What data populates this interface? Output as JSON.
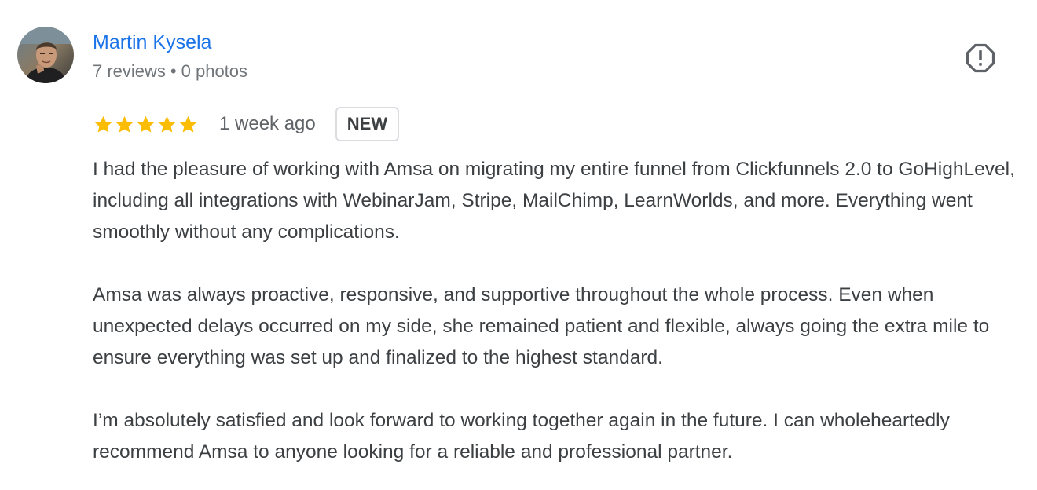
{
  "reviewer": {
    "name": "Martin Kysela",
    "reviews_count": "7 reviews",
    "separator": "•",
    "photos_count": "0 photos",
    "avatar_icon": "profile-photo"
  },
  "rating": {
    "stars": 5,
    "max_stars": 5,
    "star_color": "#fbbc04",
    "time": "1 week ago",
    "badge": "NEW"
  },
  "report": {
    "icon": "report-flag-icon"
  },
  "review": {
    "paragraphs": [
      "I had the pleasure of working with Amsa on migrating my entire funnel from Clickfunnels 2.0 to GoHighLevel, including all integrations with WebinarJam, Stripe, MailChimp, LearnWorlds, and more. Everything went smoothly without any complications.",
      "Amsa was always proactive, responsive, and supportive throughout the whole process. Even when unexpected delays occurred on my side, she remained patient and flexible, always going the extra mile to ensure everything was set up and finalized to the highest standard.",
      "I’m absolutely satisfied and look forward to working together again in the future. I can wholeheartedly recommend Amsa to anyone looking for a reliable and professional partner."
    ]
  },
  "colors": {
    "name_link": "#1a73e8",
    "meta_text": "#70757a",
    "body_text": "#3c4043",
    "star": "#fbbc04"
  }
}
